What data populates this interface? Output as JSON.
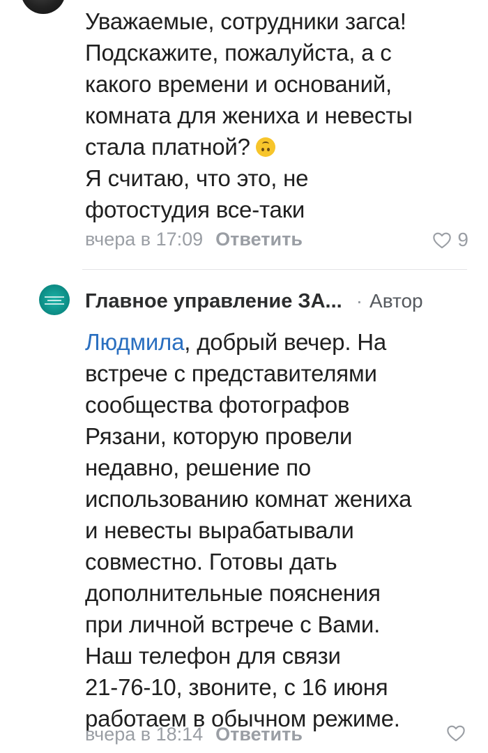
{
  "comments": [
    {
      "author_avatar": "user-avatar",
      "lines": [
        "Уважаемые, сотрудники загса!",
        "Подскажите, пожалуйста, а с",
        "какого времени и оснований,",
        "комната для жениха и невесты",
        "стала платной?",
        "Я считаю, что это, не",
        "фотостудия все-таки"
      ],
      "emoji": "upside-down-face-emoji",
      "time": "вчера в 17:09",
      "reply_label": "Ответить",
      "likes": "9",
      "like_icon": "heart-outline-icon"
    },
    {
      "author_name": "Главное управление ЗА...",
      "author_separator": "·",
      "author_tag": "Автор",
      "author_avatar": "organization-logo",
      "mention": "Людмила",
      "first_line_rest": ", добрый вечер. На",
      "lines": [
        "встрече с представителями",
        "сообщества фотографов",
        "Рязани, которую провели",
        "недавно, решение по",
        "использованию комнат жениха",
        "и невесты вырабатывали",
        "совместно. Готовы дать",
        "дополнительные пояснения",
        "при личной встрече с Вами.",
        "Наш телефон для связи",
        "21-76-10, звоните, с 16 июня",
        "работаем в обычном режиме."
      ],
      "time": "вчера в 18:14",
      "reply_label": "Ответить",
      "like_icon": "heart-outline-icon"
    }
  ],
  "colors": {
    "text": "#1f1f1f",
    "meta": "#9a9ea4",
    "mention": "#2a6fc0",
    "divider": "#e3e4e6",
    "org_avatar": "#0c8a83"
  }
}
